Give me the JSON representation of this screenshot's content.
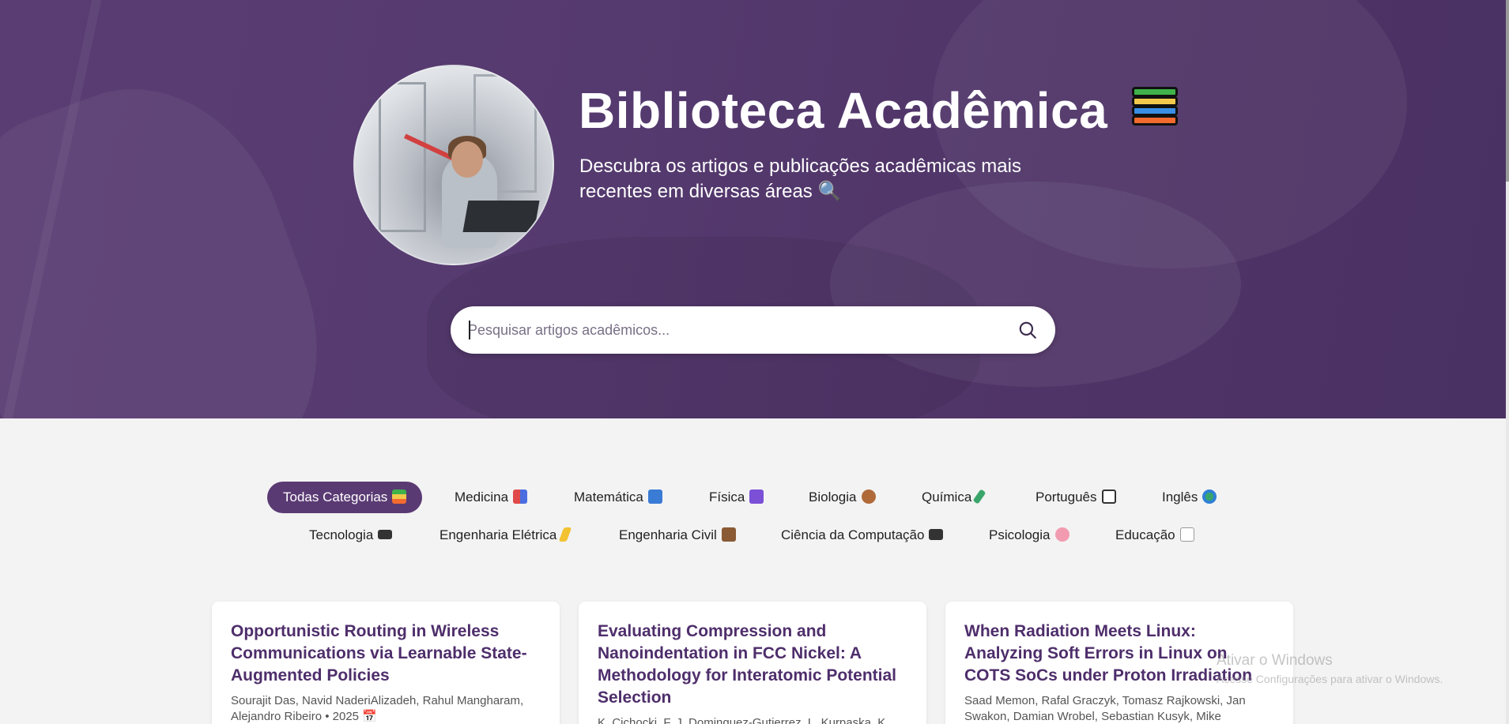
{
  "hero": {
    "title": "Biblioteca Acadêmica",
    "subtitle": "Descubra os artigos e publicações acadêmicas mais recentes em diversas áreas 🔍"
  },
  "search": {
    "placeholder": "Pesquisar artigos acadêmicos...",
    "value": "",
    "icon": "search-icon"
  },
  "categories": [
    {
      "label": "Todas Categorias",
      "active": true,
      "icon": "books-icon"
    },
    {
      "label": "Medicina",
      "icon": "medicine-icon"
    },
    {
      "label": "Matemática",
      "icon": "numbers-icon"
    },
    {
      "label": "Física",
      "icon": "atom-icon"
    },
    {
      "label": "Biologia",
      "icon": "dna-icon"
    },
    {
      "label": "Química",
      "icon": "test-tube-icon"
    },
    {
      "label": "Português",
      "icon": "book-icon"
    },
    {
      "label": "Inglês",
      "icon": "globe-icon"
    },
    {
      "label": "Tecnologia",
      "icon": "laptop-icon"
    },
    {
      "label": "Engenharia Elétrica",
      "icon": "lightning-icon"
    },
    {
      "label": "Engenharia Civil",
      "icon": "building-icon"
    },
    {
      "label": "Ciência da Computação",
      "icon": "desktop-icon"
    },
    {
      "label": "Psicologia",
      "icon": "brain-icon"
    },
    {
      "label": "Educação",
      "icon": "memo-icon"
    }
  ],
  "articles": [
    {
      "title": "Opportunistic Routing in Wireless Communications via Learnable State-Augmented Policies",
      "meta": "Sourajit Das, Navid NaderiAlizadeh, Rahul Mangharam, Alejandro Ribeiro • 2025 📅"
    },
    {
      "title": "Evaluating Compression and Nanoindentation in FCC Nickel: A Methodology for Interatomic Potential Selection",
      "meta": "K. Cichocki, F. J. Dominguez-Gutierrez, L. Kurpaska, K."
    },
    {
      "title": "When Radiation Meets Linux: Analyzing Soft Errors in Linux on COTS SoCs under Proton Irradiation",
      "meta": "Saad Memon, Rafal Graczyk, Tomasz Rajkowski, Jan Swakon, Damian Wrobel, Sebastian Kusyk, Mike Papadakis"
    }
  ],
  "os_overlay": {
    "line1": "Ativar o Windows",
    "line2": "Acesse Configurações para ativar o Windows."
  },
  "colors": {
    "hero": "#553a6f",
    "accent": "#5a3a73",
    "card_title": "#4e2e6b"
  }
}
